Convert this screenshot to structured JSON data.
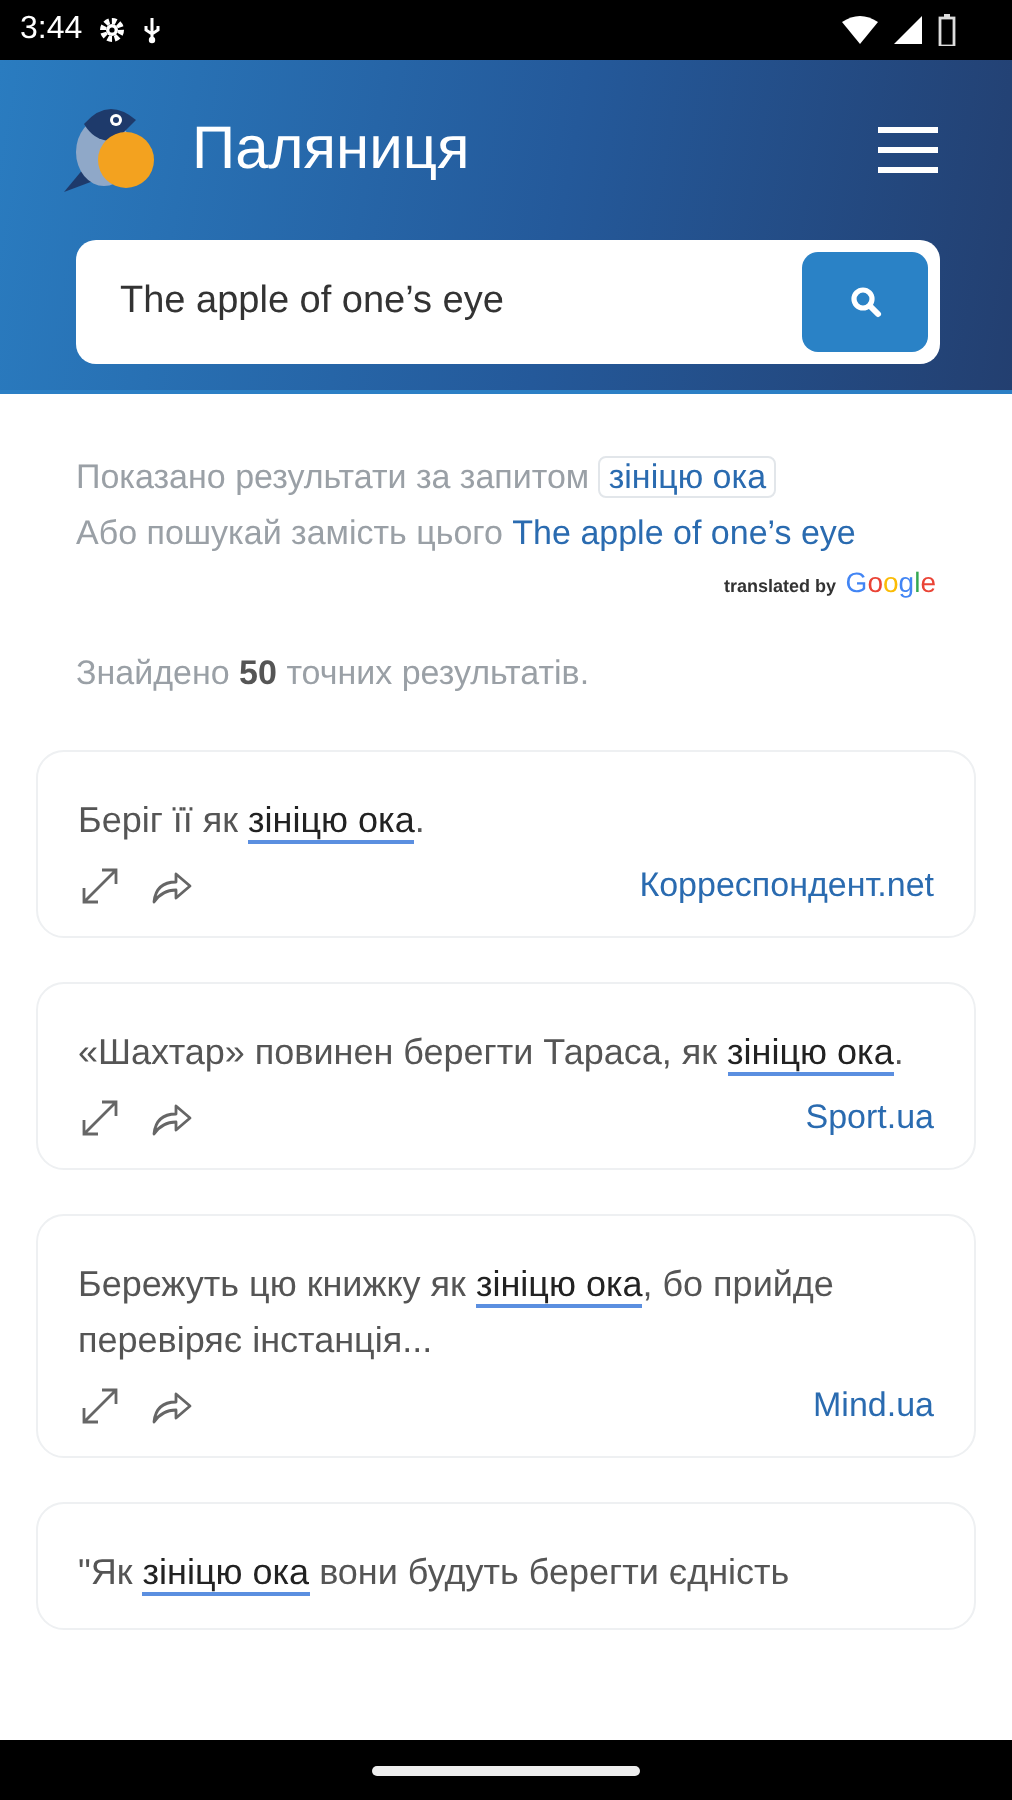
{
  "status_bar": {
    "time": "3:44"
  },
  "header": {
    "title": "Паляниця",
    "search": {
      "value": "The apple of one’s eye"
    }
  },
  "query_info": {
    "shown_label": "Показано результати за запитом",
    "shown_query": "зініцю ока",
    "alt_label": "Або пошукай замість цього",
    "alt_query": "The apple of one’s eye",
    "translated_by": "translated by",
    "translator": "Google"
  },
  "results_count": "Знайдено **50** точних результатів.",
  "examples": [
    {
      "before": "Беріг її як ",
      "match": "зініцю ока",
      "after": ".",
      "source": "Корреспондент.net"
    },
    {
      "before": "«Шахтар» повинен берегти Тараса, як ",
      "match": "зініцю ока",
      "after": ".",
      "source": "Sport.ua"
    },
    {
      "before": "Бережуть цю книжку як ",
      "match": "зініцю ока",
      "after": ", бо прийде перевіряє інстанція...",
      "source": "Mind.ua"
    },
    {
      "before": "\"Як ",
      "match": "зініцю ока",
      "after": " вони будуть берегти єдність"
    }
  ]
}
